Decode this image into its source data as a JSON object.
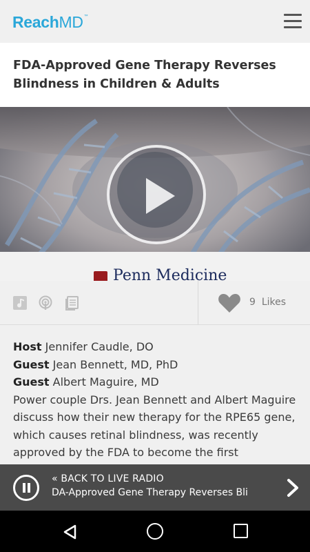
{
  "brand": {
    "reach": "Reach",
    "md": "MD",
    "tm": "™",
    "color": "#2aa7d9"
  },
  "article": {
    "title": "FDA-Approved Gene Therapy Reverses Blindness in Children & Adults"
  },
  "video": {
    "sponsor": "Penn Medicine"
  },
  "actions": {
    "icons": [
      "music-note-icon",
      "podcast-icon",
      "transcript-icon"
    ],
    "likes_count": "9",
    "likes_label": "Likes"
  },
  "credits": [
    {
      "role": "Host",
      "name": "Jennifer Caudle, DO"
    },
    {
      "role": "Guest",
      "name": "Jean Bennett, MD, PhD"
    },
    {
      "role": "Guest",
      "name": "Albert Maguire, MD"
    }
  ],
  "description": "Power couple Drs. Jean Bennett and Albert Maguire discuss how their new therapy for the RPE65 gene, which causes retinal blindness, was recently approved by the FDA to become the first",
  "player": {
    "back_label": "«  BACK TO LIVE RADIO",
    "now_playing": "DA-Approved Gene Therapy Reverses Bli"
  }
}
